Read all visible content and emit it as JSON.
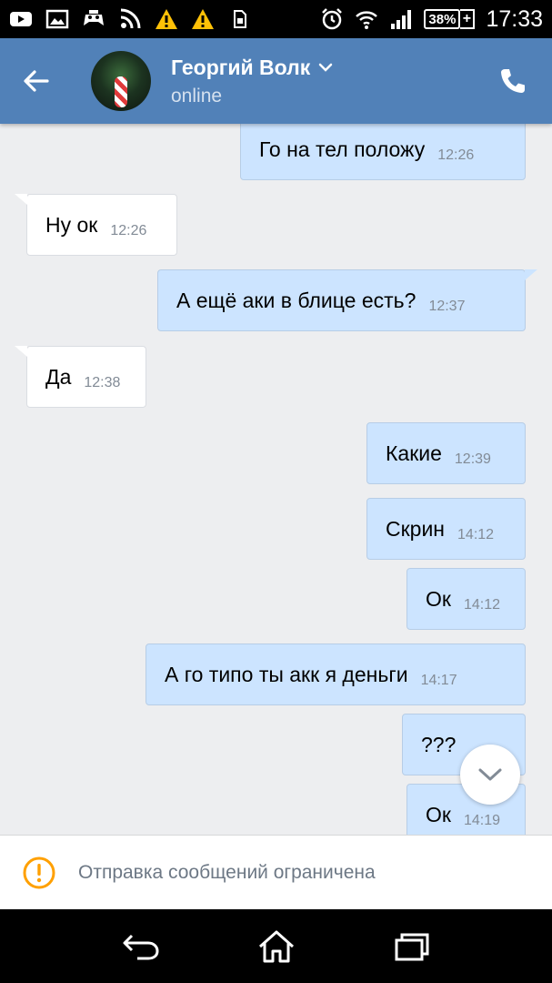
{
  "status_bar": {
    "battery": "38%",
    "battery_plus": "+",
    "time": "17:33",
    "icons": [
      "youtube-icon",
      "gallery-icon",
      "game-icon",
      "rss-icon",
      "warning-icon",
      "warning-icon",
      "sim-icon",
      "alarm-icon",
      "wifi-icon",
      "signal-icon",
      "battery-icon"
    ]
  },
  "header": {
    "contact_name": "Георгий Волк",
    "status": "online",
    "accent": "#5181b8"
  },
  "messages": [
    {
      "dir": "out",
      "text": "Го на тел положу",
      "time": "12:26"
    },
    {
      "dir": "in",
      "text": "Ну ок",
      "time": "12:26"
    },
    {
      "dir": "out",
      "text": "А ещё аки в блице есть?",
      "time": "12:37"
    },
    {
      "dir": "in",
      "text": "Да",
      "time": "12:38"
    },
    {
      "dir": "out",
      "text": "Какие",
      "time": "12:39"
    },
    {
      "dir": "out",
      "text": "Скрин",
      "time": "14:12"
    },
    {
      "dir": "out",
      "text": "Ок",
      "time": "14:12"
    },
    {
      "dir": "out",
      "text": "А го типо ты акк я деньги",
      "time": "14:17"
    },
    {
      "dir": "out",
      "text": "???",
      "time": ""
    },
    {
      "dir": "out",
      "text": "Ок",
      "time": "14:19"
    }
  ],
  "restricted": {
    "text": "Отправка сообщений ограничена",
    "icon_color": "#ffa000"
  },
  "colors": {
    "outgoing_bubble": "#cce4ff",
    "incoming_bubble": "#ffffff",
    "chat_bg": "#edeef0"
  }
}
